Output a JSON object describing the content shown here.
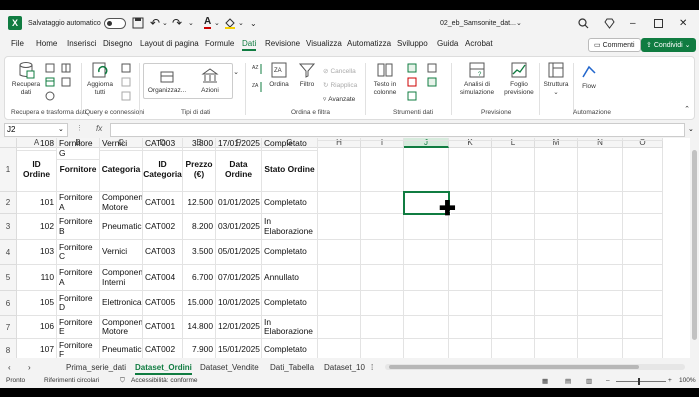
{
  "titlebar": {
    "app_icon": "excel-logo",
    "autosave_label": "Salvataggio automatico",
    "filename": "02_eb_Samsonite_dat...",
    "icons": [
      "save-icon",
      "undo-icon",
      "redo-icon",
      "font-color-icon",
      "fill-color-icon",
      "chevron-down-icon",
      "search-icon",
      "diamond-icon",
      "minimize-icon",
      "restore-icon",
      "close-icon"
    ]
  },
  "menu": {
    "items": [
      "File",
      "Home",
      "Inserisci",
      "Disegno",
      "Layout di pagina",
      "Formule",
      "Dati",
      "Revisione",
      "Visualizza",
      "Automatizza",
      "Sviluppo",
      "Guida",
      "Acrobat"
    ],
    "active": "Dati",
    "comments_label": "Commenti",
    "share_label": "Condividi"
  },
  "ribbon": {
    "get_data": "Recupera dati",
    "refresh_all": "Aggiorna tutti",
    "organization": "Organizzaz...",
    "stocks": "Azioni",
    "sort": "Ordina",
    "filter": "Filtro",
    "clear": "Cancella",
    "reapply": "Riapplica",
    "advanced": "Avanzate",
    "text_to_columns": "Testo in colonne",
    "what_if": "Analisi di simulazione",
    "forecast_sheet": "Foglio previsione",
    "outline": "Struttura",
    "flow": "Flow",
    "groups": [
      "Recupera e trasforma dati",
      "Query e connessioni",
      "Tipi di dati",
      "Ordina e filtra",
      "Strumenti dati",
      "Previsione",
      "Automazione"
    ],
    "accent": "#107c41"
  },
  "formula_bar": {
    "name_box": "J2",
    "fx": "fx",
    "value": ""
  },
  "grid": {
    "columns": [
      "A",
      "B",
      "C",
      "D",
      "E",
      "F",
      "G",
      "H",
      "I",
      "J",
      "K",
      "L",
      "M",
      "N",
      "O"
    ],
    "selected_column": "J",
    "rows": [
      "1",
      "2",
      "3",
      "4",
      "5",
      "6",
      "7",
      "8"
    ],
    "headers": [
      "ID Ordine",
      "Fornitore",
      "Categoria",
      "ID Categoria",
      "Prezzo (€)",
      "Data Ordine",
      "Stato Ordine"
    ],
    "data": [
      [
        "101",
        "Fornitore A",
        "Componenti Motore",
        "CAT001",
        "12.500",
        "01/01/2025",
        "Completato"
      ],
      [
        "102",
        "Fornitore B",
        "Pneumatici",
        "CAT002",
        "8.200",
        "03/01/2025",
        "In Elaborazione"
      ],
      [
        "103",
        "Fornitore C",
        "Vernici",
        "CAT003",
        "3.500",
        "05/01/2025",
        "Completato"
      ],
      [
        "110",
        "Fornitore A",
        "Componenti Interni",
        "CAT004",
        "6.700",
        "07/01/2025",
        "Annullato"
      ],
      [
        "105",
        "Fornitore D",
        "Elettronica",
        "CAT005",
        "15.000",
        "10/01/2025",
        "Completato"
      ],
      [
        "106",
        "Fornitore E",
        "Componenti Motore",
        "CAT001",
        "14.800",
        "12/01/2025",
        "In Elaborazione"
      ],
      [
        "107",
        "Fornitore F",
        "Pneumatici",
        "CAT002",
        "7.900",
        "15/01/2025",
        "Completato"
      ],
      [
        "108",
        "Fornitore G",
        "Vernici",
        "CAT003",
        "3.800",
        "17/01/2025",
        "Completato"
      ]
    ]
  },
  "sheets": {
    "tabs": [
      "Prima_serie_dati",
      "Dataset_Ordini",
      "Dataset_Vendite",
      "Dati_Tabella",
      "Dataset_10"
    ],
    "active": "Dataset_Ordini"
  },
  "status": {
    "ready": "Pronto",
    "circular": "Riferimenti circolari",
    "accessibility": "Accessibilità: conforme",
    "zoom": "100%"
  }
}
